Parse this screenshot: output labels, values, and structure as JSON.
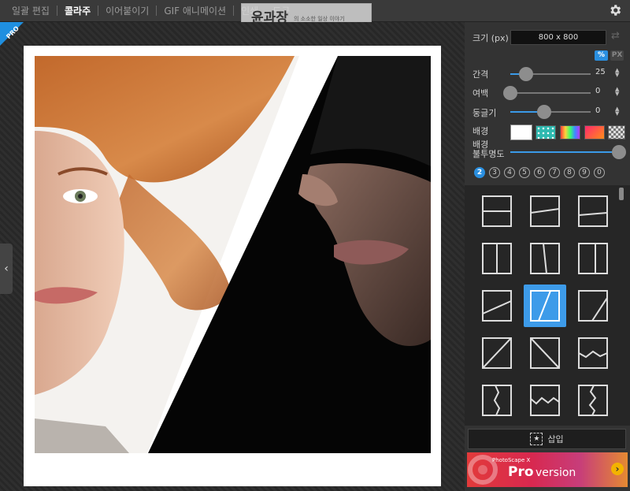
{
  "menu": {
    "items": [
      "일괄 편집",
      "콜라주",
      "이어붙이기",
      "GIF 애니메이션",
      "인쇄",
      "도구"
    ]
  },
  "watermark": {
    "title": "윤과장",
    "subtitle": "의 소소한 일상 이야기"
  },
  "badge": {
    "text": "PRO"
  },
  "panel": {
    "size_label": "크기 (px)",
    "size_value": "800 x 800",
    "unit_percent": "%",
    "unit_px": "PX",
    "spacing": {
      "label": "간격",
      "value": "25",
      "fraction": 0.2
    },
    "margin": {
      "label": "여백",
      "value": "0",
      "fraction": 0
    },
    "roundness": {
      "label": "둥글기",
      "value": "0",
      "fraction": 0.42
    },
    "background_label": "배경",
    "opacity_label_1": "배경",
    "opacity_label_2": "불투명도",
    "opacity_fraction": 1.0,
    "counts": [
      "2",
      "3",
      "4",
      "5",
      "6",
      "7",
      "8",
      "9",
      "0"
    ],
    "insert_label": "삽입",
    "insert_icon": "★"
  },
  "ad": {
    "brand": "PhotoScape X",
    "pro": "Pro",
    "version": "version",
    "arrow": "›"
  },
  "colors": {
    "accent": "#2a8fe0",
    "panel": "#333333",
    "frame": "#ffffff"
  },
  "icons": {
    "settings": "gear-icon",
    "collapse": "chevron-left-icon",
    "swap": "swap-icon",
    "insert": "star-icon"
  },
  "collapse_glyph": "‹",
  "swap_glyph": "⇄"
}
